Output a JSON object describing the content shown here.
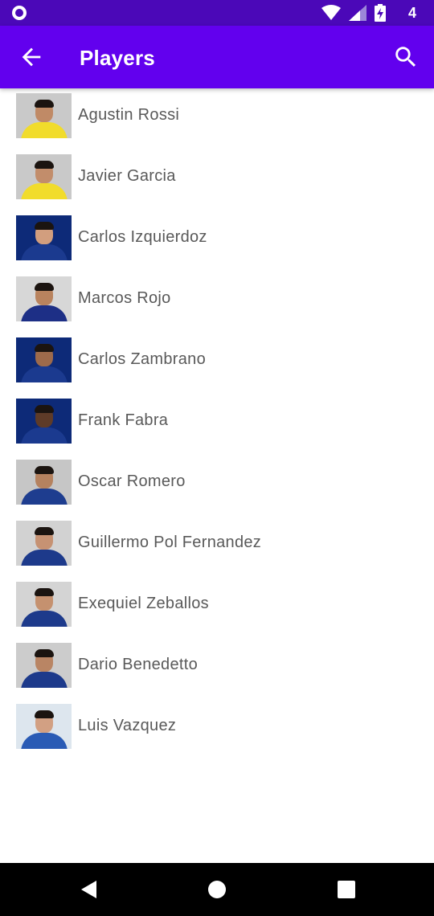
{
  "status_bar": {
    "time": "4",
    "icons": [
      "app-notification-icon",
      "wifi-icon",
      "signal-icon",
      "battery-charging-icon"
    ]
  },
  "app_bar": {
    "title": "Players",
    "back_icon": "arrow-left-icon",
    "search_icon": "search-icon"
  },
  "players": [
    {
      "name": "Agustin Rossi",
      "photo_bg": "#c9c9c9",
      "shirt": "#f1dc2b",
      "skin": "#c08a66"
    },
    {
      "name": "Javier Garcia",
      "photo_bg": "#c9c9c9",
      "shirt": "#f1dc2b",
      "skin": "#c28d6b"
    },
    {
      "name": "Carlos Izquierdoz",
      "photo_bg": "#0d2a78",
      "shirt": "#1b3a8f",
      "skin": "#d29e7e"
    },
    {
      "name": "Marcos Rojo",
      "photo_bg": "#d7d7d7",
      "shirt": "#1d2f86",
      "skin": "#b9835e"
    },
    {
      "name": "Carlos Zambrano",
      "photo_bg": "#0d2a78",
      "shirt": "#1b3a8f",
      "skin": "#9d6a4b"
    },
    {
      "name": "Frank Fabra",
      "photo_bg": "#0d2a78",
      "shirt": "#1b3a8f",
      "skin": "#5e3b28"
    },
    {
      "name": "Oscar Romero",
      "photo_bg": "#c6c6c6",
      "shirt": "#1e3d8f",
      "skin": "#b5825f"
    },
    {
      "name": "Guillermo Pol Fernandez",
      "photo_bg": "#d2d2d2",
      "shirt": "#1d3a8b",
      "skin": "#c69273"
    },
    {
      "name": "Exequiel Zeballos",
      "photo_bg": "#d4d4d4",
      "shirt": "#1d3a8b",
      "skin": "#c5916f"
    },
    {
      "name": "Dario Benedetto",
      "photo_bg": "#cccccc",
      "shirt": "#1d3a8b",
      "skin": "#b98564"
    },
    {
      "name": "Luis Vazquez",
      "photo_bg": "#dde6ee",
      "shirt": "#2a5bb5",
      "skin": "#d2a083"
    }
  ],
  "nav_bar": {
    "buttons": [
      "back-triangle-icon",
      "home-circle-icon",
      "recents-square-icon"
    ]
  }
}
